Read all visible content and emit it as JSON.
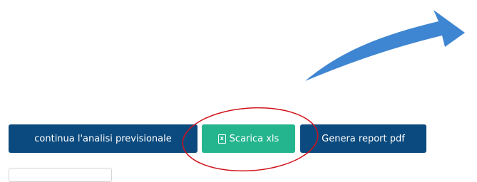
{
  "buttons": {
    "continue_label": "continua l'analisi previsionale",
    "xls_label": "Scarica xls",
    "pdf_label": "Genera report pdf"
  },
  "icons": {
    "xls": "excel-file-icon",
    "arrow": "curved-arrow-icon"
  },
  "colors": {
    "primary": "#0b4a7e",
    "success": "#24b58f",
    "arrow": "#3f86d2",
    "annotation": "#d0121b"
  }
}
